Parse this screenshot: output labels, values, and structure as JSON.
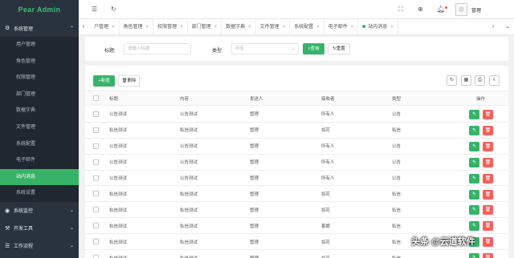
{
  "sidebar": {
    "logo": "Pear Admin",
    "group_system_manage": "系统管理",
    "items": [
      "用户管理",
      "角色管理",
      "权限管理",
      "部门管理",
      "数据字典",
      "文件管理",
      "系统配置",
      "电子邮件",
      "站内消息",
      "系统设置"
    ],
    "active_index": 8,
    "group_monitor": "系统监控",
    "group_devtools": "开发工具",
    "group_workflow": "工作流程"
  },
  "header": {
    "user": "管理"
  },
  "tabs": [
    "户管理",
    "角色管理",
    "权限管理",
    "部门管理",
    "数据字典",
    "文件管理",
    "系统配置",
    "电子邮件",
    "站内消息"
  ],
  "active_tab_index": 8,
  "search": {
    "title_label": "标题:",
    "title_placeholder": "请输入标题",
    "type_label": "类型:",
    "type_value": "所有",
    "query_label": "查询",
    "reset_label": "重置"
  },
  "toolbar": {
    "add_label": "新增",
    "delete_label": "删除"
  },
  "table": {
    "columns": [
      "标题",
      "内容",
      "发送人",
      "接收者",
      "类型",
      "操作"
    ],
    "rows": [
      {
        "title": "公告测试",
        "content": "公告测试",
        "sender": "管理",
        "receiver": "所有人",
        "type": "公告"
      },
      {
        "title": "私信测试",
        "content": "私信测试",
        "sender": "管理",
        "receiver": "如花",
        "type": "私信"
      },
      {
        "title": "公告测试",
        "content": "公告测试",
        "sender": "管理",
        "receiver": "所有人",
        "type": "公告"
      },
      {
        "title": "公告测试",
        "content": "公告测试",
        "sender": "管理",
        "receiver": "所有人",
        "type": "公告"
      },
      {
        "title": "公告测试",
        "content": "公告测试",
        "sender": "管理",
        "receiver": "所有人",
        "type": "公告"
      },
      {
        "title": "私信测试",
        "content": "私信测试",
        "sender": "管理",
        "receiver": "如花",
        "type": "私信"
      },
      {
        "title": "私信测试",
        "content": "私信测试",
        "sender": "管理",
        "receiver": "如花",
        "type": "私信"
      },
      {
        "title": "私信测试",
        "content": "私信测试",
        "sender": "管理",
        "receiver": "葛娜",
        "type": "私信"
      },
      {
        "title": "私信测试",
        "content": "私信测试",
        "sender": "管理",
        "receiver": "如花",
        "type": "私信"
      },
      {
        "title": "私信测试",
        "content": "私信测试",
        "sender": "管理",
        "receiver": "如花",
        "type": "私信"
      }
    ]
  },
  "watermark": "头条 @云道软件",
  "colors": {
    "sidebar_bg": "#28333e",
    "accent": "#36b368",
    "danger": "#f45f5f"
  }
}
